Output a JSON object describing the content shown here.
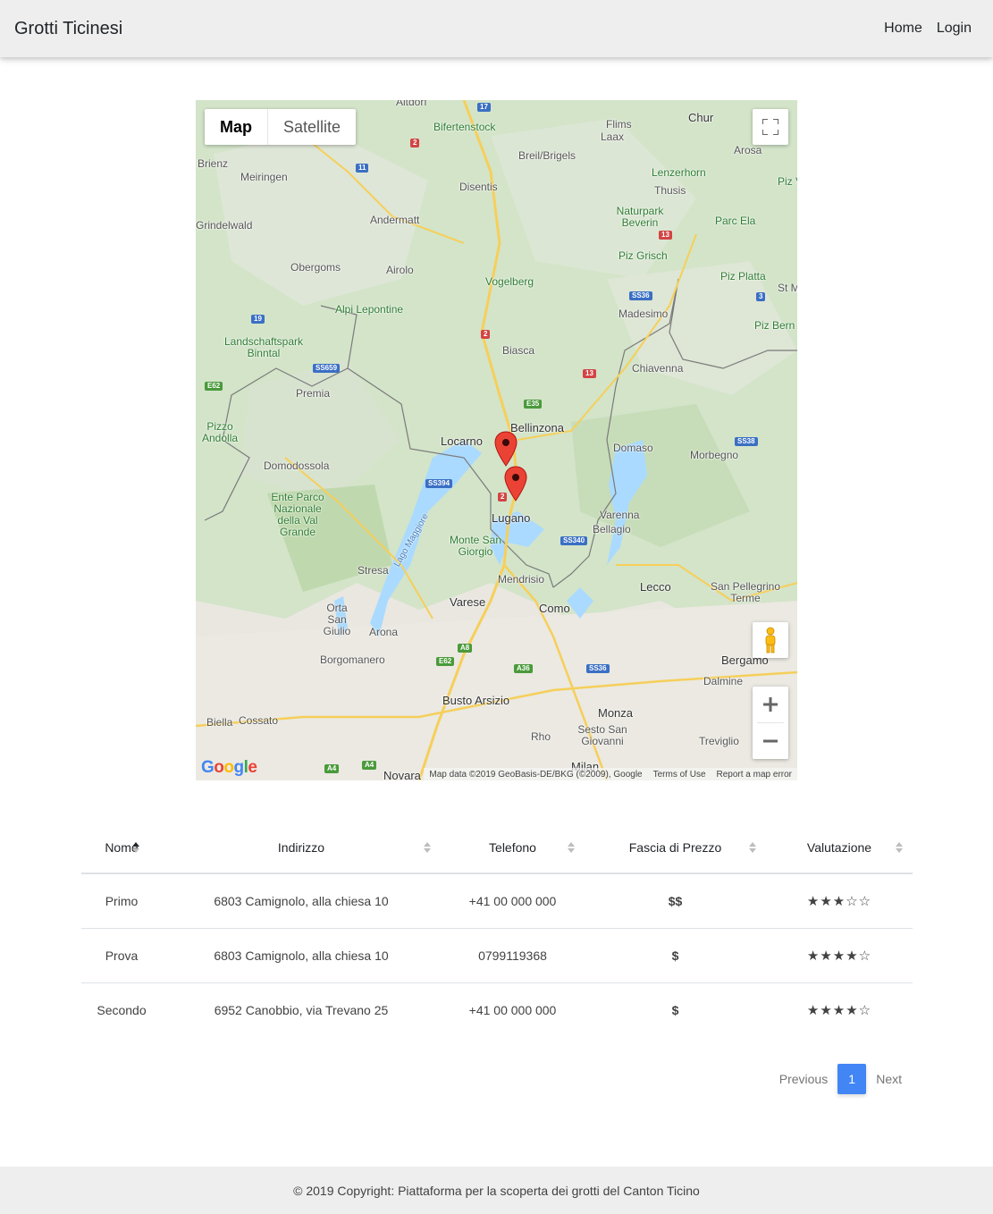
{
  "navbar": {
    "brand": "Grotti Ticinesi",
    "links": [
      "Home",
      "Login"
    ]
  },
  "map": {
    "type_buttons": [
      "Map",
      "Satellite"
    ],
    "active_type": "Map",
    "attribution": [
      "Map data ©2019 GeoBasis-DE/BKG (©2009), Google",
      "Terms of Use",
      "Report a map error"
    ],
    "google_logo": "Google",
    "place_labels": [
      "Altdorf",
      "Chur",
      "Flims",
      "Laax",
      "Bifertenstock",
      "Brienz",
      "Meiringen",
      "Breil/Brigels",
      "Arosa",
      "Disentis",
      "Lenzerhorn",
      "Thusis",
      "Piz V",
      "Andermatt",
      "Grindelwald",
      "Naturpark Beverin",
      "Parc Ela",
      "Obergoms",
      "Airolo",
      "Piz Grisch",
      "Piz Platta",
      "Vogelberg",
      "St M",
      "Alpi Lepontine",
      "Madesimo",
      "Piz Bern",
      "Landschaftspark Binntal",
      "Biasca",
      "Chiavenna",
      "Premia",
      "Bellinzona",
      "Locarno",
      "Domaso",
      "Pizzo Andolla",
      "Domodossola",
      "Morbegno",
      "Ente Parco Nazionale della Val Grande",
      "Lugano",
      "Varenna",
      "Bellagio",
      "Monte San Giorgio",
      "Lago Maggiore",
      "Stresa",
      "Mendrisio",
      "Lecco",
      "San Pellegrino Terme",
      "Varese",
      "Como",
      "Orta San Giulio",
      "Arona",
      "Bergamo",
      "Borgomanero",
      "Dalmine",
      "Busto Arsizio",
      "Monza",
      "Biella",
      "Cossato",
      "Sesto San Giovanni",
      "Treviglio",
      "Rho",
      "Novara",
      "Milan"
    ],
    "road_shields": [
      "17",
      "2",
      "11",
      "13",
      "SS36",
      "3",
      "19",
      "2",
      "SS659",
      "13",
      "E62",
      "E35",
      "SS38",
      "SS394",
      "2",
      "SS340",
      "A8",
      "E62",
      "A36",
      "SS36",
      "A4",
      "A4"
    ],
    "markers": 2
  },
  "table": {
    "columns": [
      "Nome",
      "Indirizzo",
      "Telefono",
      "Fascia di Prezzo",
      "Valutazione"
    ],
    "sorted_column": "Nome",
    "rows": [
      {
        "nome": "Primo",
        "indirizzo": "6803 Camignolo, alla chiesa 10",
        "telefono": "+41 00 000 000",
        "prezzo": "$$",
        "valutazione": "★★★☆☆",
        "rating": 3
      },
      {
        "nome": "Prova",
        "indirizzo": "6803 Camignolo, alla chiesa 10",
        "telefono": "0799119368",
        "prezzo": "$",
        "valutazione": "★★★★☆",
        "rating": 4
      },
      {
        "nome": "Secondo",
        "indirizzo": "6952 Canobbio, via Trevano 25",
        "telefono": "+41 00 000 000",
        "prezzo": "$",
        "valutazione": "★★★★☆",
        "rating": 4
      }
    ]
  },
  "pagination": {
    "previous": "Previous",
    "current": "1",
    "next": "Next"
  },
  "footer": {
    "text": "© 2019 Copyright: Piattaforma per la scoperta dei grotti del Canton Ticino"
  },
  "colors": {
    "navbar_bg": "#eeeeee",
    "page_active": "#4285f4",
    "marker": "#ea4335"
  }
}
